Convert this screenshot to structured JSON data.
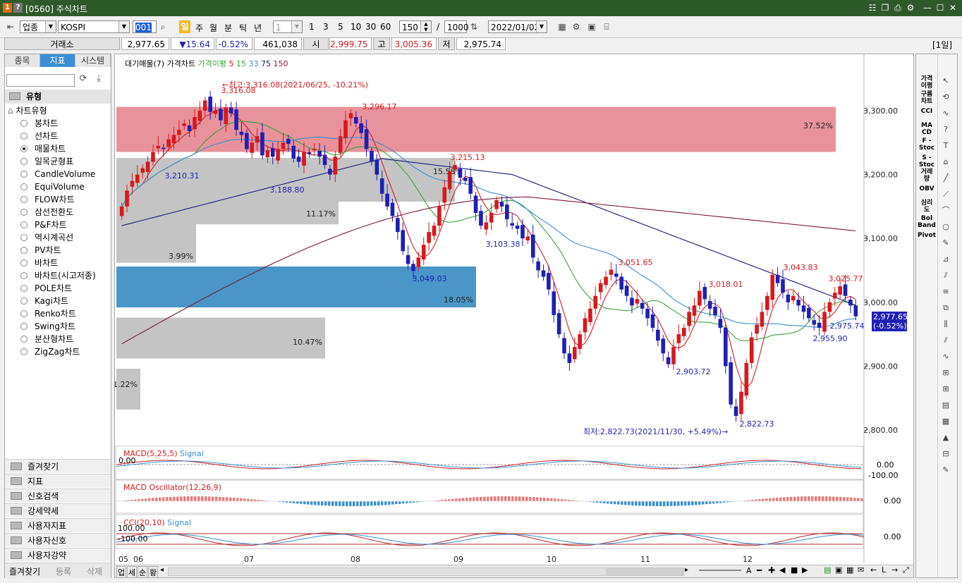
{
  "window": {
    "logo_a": "1",
    "logo_b": "?",
    "title": "[0560] 주식차트"
  },
  "toolbar": {
    "market": "업종",
    "index": "KOSPI",
    "code": "001",
    "periods": [
      "일",
      "주",
      "월",
      "분",
      "틱",
      "년"
    ],
    "interval": "1",
    "multipliers": [
      "1",
      "3",
      "5",
      "10",
      "30",
      "60"
    ],
    "count": "150",
    "slash": "/",
    "max_count": "1000",
    "date": "2022/01/02"
  },
  "quote": {
    "exchange": "거래소",
    "price": "2,977.65",
    "change": "▼15.64",
    "change_pct": "-0.52%",
    "volume": "461,038",
    "open_label": "시",
    "open": "2,999.75",
    "high_label": "고",
    "high": "3,005.36",
    "low_label": "저",
    "low": "2,975.74",
    "period": "[1일]"
  },
  "left_panel": {
    "tabs": [
      "종목",
      "지표",
      "시스템"
    ],
    "section_title": "유형",
    "tree_root": "차트유형",
    "chart_types": [
      "봉차트",
      "선차트",
      "매물차트",
      "일목균형표",
      "CandleVolume",
      "EquiVolume",
      "FLOW차트",
      "삼선전환도",
      "P&F차트",
      "역시계곡선",
      "PV차트",
      "바차트",
      "바차트(시고저종)",
      "POLE차트",
      "Kagi차트",
      "Renko차트",
      "Swing차트",
      "분산형차트",
      "ZigZag차트"
    ],
    "selected_type": "매물차트",
    "folders": [
      "즐겨찾기",
      "지표",
      "신호검색",
      "강세약세",
      "사용자지표",
      "사용자신호",
      "사용자강약"
    ],
    "bottom_buttons": [
      "즐겨찾기",
      "등록",
      "삭제"
    ]
  },
  "main_chart": {
    "legend": {
      "item1": "대기매물(7)",
      "item2": "가격차트",
      "item3": "가격이평",
      "ma5": "5",
      "ma15": "15",
      "ma33": "33",
      "ma75": "75",
      "ma150": "150"
    },
    "y_ticks": [
      "3,300.00",
      "3,200.00",
      "3,100.00",
      "3,000.00",
      "2,900.00",
      "2,800.00"
    ],
    "high_note": "←최고:3,316.08(2021/06/25, -10.21%)",
    "low_note": "최저:2,822.73(2021/11/30, +5.49%)→",
    "price_tag": "2,977.65",
    "price_tag_pct": "(-0.52%)",
    "annotations": [
      "3,316.08",
      "3,296.17",
      "3,210.31",
      "3,188.80",
      "3,215.13",
      "3,103.38",
      "3,049.03",
      "3,051.65",
      "3,018.01",
      "3,043.83",
      "3,025.77",
      "2,975.74",
      "2,955.90",
      "2,903.72",
      "2,822.73"
    ],
    "volume_profile_pct": [
      "37.52%",
      "15.58%",
      "11.17%",
      "3.99%",
      "18.05%",
      "10.47%",
      "1.22%"
    ]
  },
  "macd_panel": {
    "title": "MACD(5,25,5)",
    "signal": "Signal",
    "left_value": "0.00",
    "values": [
      "0.00",
      "-100.00"
    ]
  },
  "osc_panel": {
    "title": "MACD Oscillator(12,26,9)",
    "value": "0.00"
  },
  "cci_panel": {
    "title": "CCI(20,10)",
    "signal": "Signal",
    "upper": "100.00",
    "lower": "-100.00",
    "value": "0.00"
  },
  "x_axis": {
    "labels": [
      "05",
      "06",
      "07",
      "08",
      "09",
      "10",
      "11",
      "12"
    ]
  },
  "bottom_toolbar": {
    "tabs": [
      "업",
      "세",
      "순",
      "황"
    ]
  },
  "right_toolbar": {
    "items": [
      "가격\n이평",
      "구름\n차트",
      "CCI",
      "MA\nCD",
      "F -\nStoc",
      "S -\nStoc",
      "거래\n량",
      "OBV",
      "심리\n도",
      "Bol\nBand",
      "Pivot"
    ]
  },
  "colors": {
    "title_bg": "#2e5a2a",
    "up": "#d7191c",
    "down": "#1f1fb4",
    "ma5": "#cc2222",
    "ma15": "#3aa33a",
    "ma33": "#3a8fd0",
    "ma75": "#1a1a7a",
    "ma150": "#7a1a3a",
    "vp_red": "#e8929b",
    "vp_gray": "#c4c4c4",
    "vp_blue": "#4a96c8"
  }
}
